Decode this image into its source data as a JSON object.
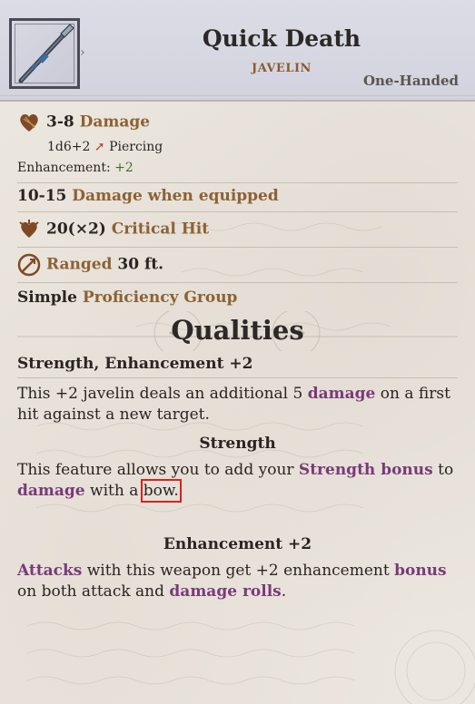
{
  "header": {
    "title": "Quick Death",
    "subtitle": "JAVELIN",
    "handedness": "One-Handed"
  },
  "stats": {
    "damage_range": "3-8",
    "damage_label": "Damage",
    "damage_dice": "1d6+2",
    "damage_type": "Piercing",
    "enhancement_label": "Enhancement:",
    "enhancement_value": "+2",
    "equipped_range": "10-15",
    "equipped_label": "Damage when equipped",
    "crit_value": "20(×2)",
    "crit_label": "Critical Hit",
    "range_label": "Ranged",
    "range_value": "30 ft.",
    "proficiency_prefix": "Simple",
    "proficiency_label": "Proficiency Group"
  },
  "qualities": {
    "heading": "Qualities",
    "quality_title": "Strength, Enhancement +2",
    "quality_desc_1": "This +2 javelin deals an additional 5",
    "quality_desc_kw": "damage",
    "quality_desc_2": "on a first hit against a new target."
  },
  "strength": {
    "heading": "Strength",
    "text_1": "This feature allows you to add your",
    "kw_1": "Strength bonus",
    "text_2": "to",
    "kw_2": "damage",
    "text_3": "with a",
    "text_4": "bow."
  },
  "enhancement": {
    "heading": "Enhancement +2",
    "kw_1": "Attacks",
    "text_1": "with this weapon get +2 enhancement",
    "kw_2": "bonus",
    "text_2": "on both attack and",
    "kw_3": "damage rolls",
    "text_3": "."
  },
  "colors": {
    "gold": "#8c6234",
    "purple": "#7a3a78",
    "green": "#3e6a2e",
    "highlight": "#e01e1e"
  },
  "icons": [
    "javelin-icon",
    "damage-heart-icon",
    "critical-icon",
    "ranged-icon"
  ]
}
